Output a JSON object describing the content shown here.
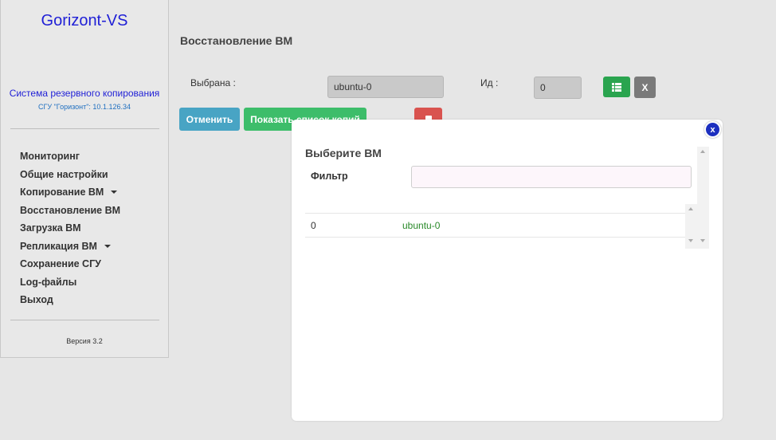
{
  "sidebar": {
    "brand": "Gorizont-VS",
    "system_title": "Система резервного копирования",
    "system_subtitle": "СГУ \"Горизонт\": 10.1.126.34",
    "menu": [
      {
        "label": "Мониторинг",
        "has_caret": false
      },
      {
        "label": "Общие настройки",
        "has_caret": false
      },
      {
        "label": "Копирование ВМ",
        "has_caret": true
      },
      {
        "label": "Восстановление ВМ",
        "has_caret": false
      },
      {
        "label": "Загрузка ВМ",
        "has_caret": false
      },
      {
        "label": "Репликация ВМ",
        "has_caret": true
      },
      {
        "label": "Сохранение СГУ",
        "has_caret": false
      },
      {
        "label": "Log-файлы",
        "has_caret": false
      },
      {
        "label": "Выход",
        "has_caret": false
      }
    ],
    "version": "Версия 3.2"
  },
  "main": {
    "title": "Восстановление ВМ",
    "selected_label": "Выбрана :",
    "selected_value": "ubuntu-0",
    "id_label": "Ид :",
    "id_value": "0",
    "btn_x": "X",
    "btn_cancel": "Отменить",
    "btn_show_copies": "Показать список копий"
  },
  "modal": {
    "close_label": "x",
    "title": "Выберите ВМ",
    "filter_label": "Фильтр",
    "filter_value": "",
    "rows": [
      {
        "id": "0",
        "name": "ubuntu-0"
      }
    ]
  },
  "colors": {
    "brand": "#1f1fd6",
    "btn_list": "#2aa44f",
    "btn_cancel": "#48a4c4",
    "btn_show": "#3dbd6a",
    "btn_delete": "#d9534f",
    "modal_close": "#1c2fbf",
    "vm_name": "#2a8a2a"
  }
}
